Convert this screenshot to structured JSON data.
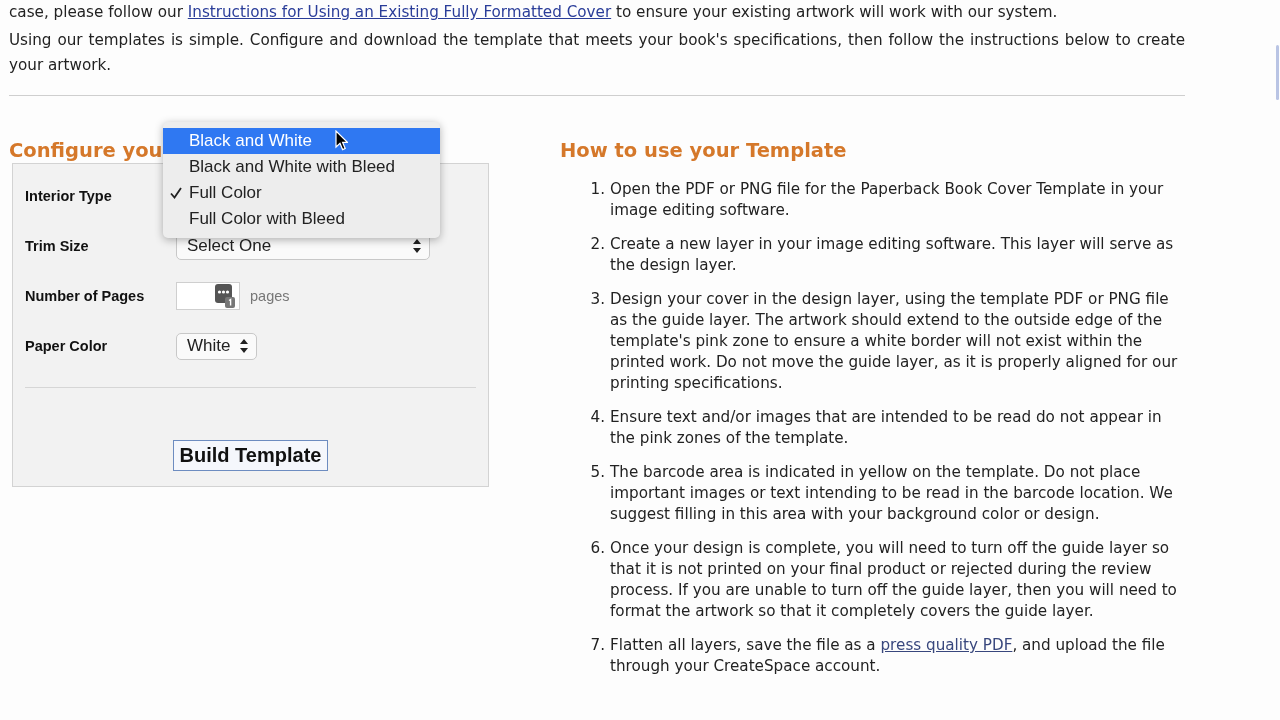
{
  "intro": [
    {
      "before": "case, please follow our ",
      "link": "Instructions for Using an Existing Fully Formatted Cover",
      "after": " to ensure your existing artwork will work with our system."
    },
    {
      "before": "Using our templates is simple. Configure and download the template that meets your book's specifications, then follow the instructions below to create your artwork."
    }
  ],
  "configure": {
    "heading": "Configure you",
    "fields": [
      {
        "label": "Interior Type",
        "kind": "menu",
        "options": [
          {
            "label": "Black and White",
            "highlighted": true,
            "checked": false
          },
          {
            "label": "Black and White with Bleed",
            "highlighted": false,
            "checked": false
          },
          {
            "label": "Full Color",
            "highlighted": false,
            "checked": true
          },
          {
            "label": "Full Color with Bleed",
            "highlighted": false,
            "checked": false
          }
        ]
      },
      {
        "label": "Trim Size",
        "kind": "select",
        "value": "Select One"
      },
      {
        "label": "Number of Pages",
        "kind": "number",
        "unit": "pages"
      },
      {
        "label": "Paper Color",
        "kind": "select",
        "value": "White"
      }
    ],
    "button": "Build Template"
  },
  "instructions": {
    "heading": "How to use your Template",
    "steps": [
      {
        "number": "1.",
        "text": "Open the PDF or PNG file for the Paperback Book Cover Template in your image editing software."
      },
      {
        "number": "2.",
        "text": "Create a new layer in your image editing software. This layer will serve as the design layer."
      },
      {
        "number": "3.",
        "text": "Design your cover in the design layer, using the template PDF or PNG file as the guide layer. The artwork should extend to the outside edge of the template's pink zone to ensure a white border will not exist within the printed work. Do not move the guide layer, as it is properly aligned for our printing specifications."
      },
      {
        "number": "4.",
        "text": "Ensure text and/or images that are intended to be read do not appear in the pink zones of the template."
      },
      {
        "number": "5.",
        "text": "The barcode area is indicated in yellow on the template. Do not place important images or text intending to be read in the barcode location. We suggest filling in this area with your background color or design."
      },
      {
        "number": "6.",
        "text": "Once your design is complete, you will need to turn off the guide layer so that it is not printed on your final product or rejected during the review process. If you are unable to turn off the guide layer, then you will need to format the artwork so that it completely covers the guide layer."
      },
      {
        "number": "7.",
        "text": "Flatten all layers, save the file as a ",
        "link": "press quality PDF",
        "after": ", and upload the file through your CreateSpace account."
      }
    ]
  }
}
